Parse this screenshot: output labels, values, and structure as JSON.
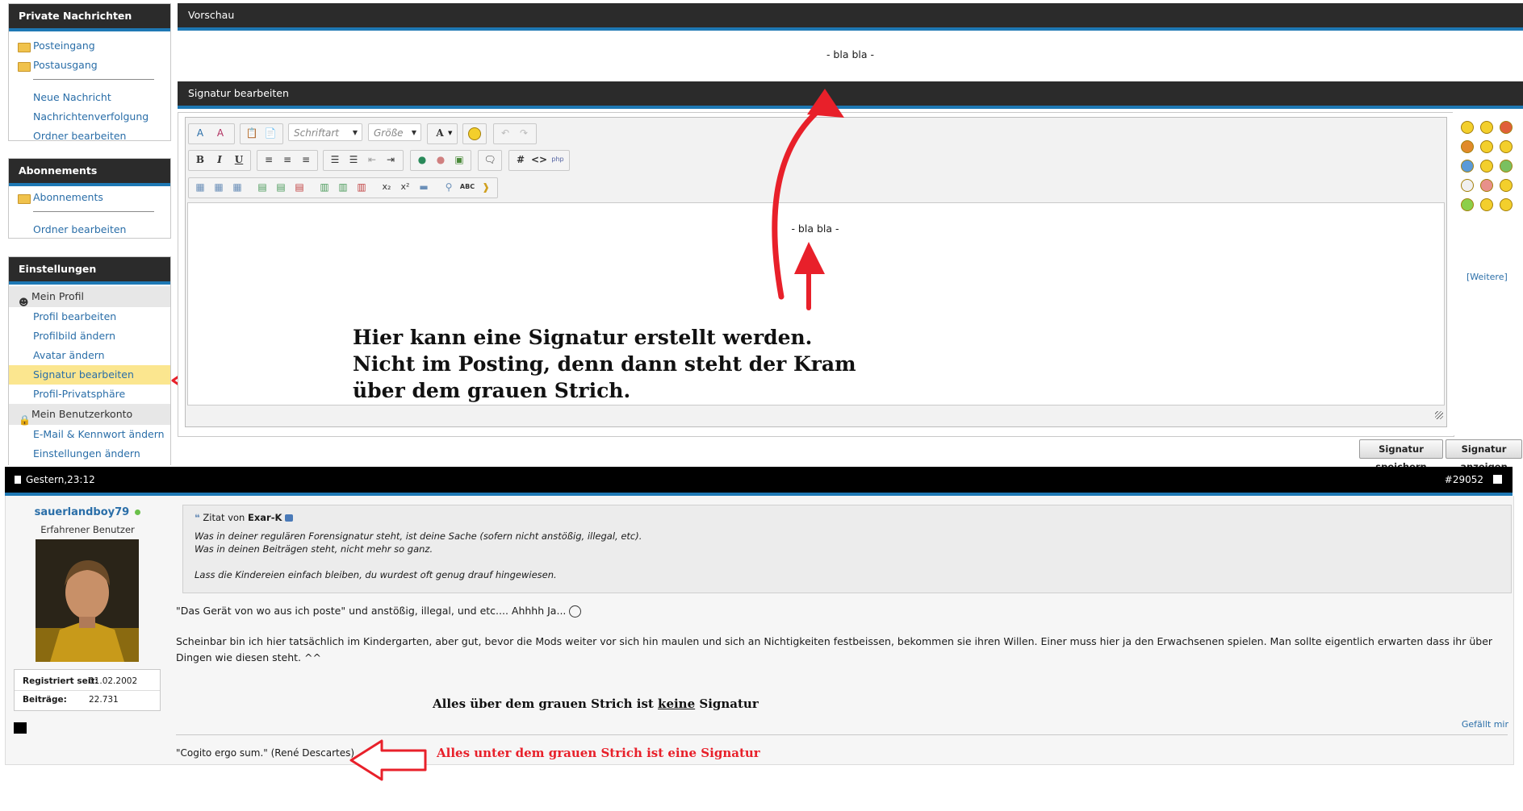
{
  "sidebar": {
    "private_messages": {
      "title": "Private Nachrichten",
      "items": [
        "Posteingang",
        "Postausgang"
      ],
      "links": [
        "Neue Nachricht",
        "Nachrichtenverfolgung",
        "Ordner bearbeiten"
      ]
    },
    "subscriptions": {
      "title": "Abonnements",
      "items": [
        "Abonnements"
      ],
      "links": [
        "Ordner bearbeiten"
      ]
    },
    "settings": {
      "title": "Einstellungen",
      "my_profile": "Mein Profil",
      "profile_items": [
        "Profil bearbeiten",
        "Profilbild ändern",
        "Avatar ändern",
        "Signatur bearbeiten",
        "Profil-Privatsphäre"
      ],
      "my_account": "Mein Benutzerkonto",
      "account_items": [
        "E-Mail & Kennwort ändern",
        "Einstellungen ändern"
      ]
    }
  },
  "preview": {
    "title": "Vorschau",
    "text": "- bla bla -"
  },
  "editor": {
    "title": "Signatur bearbeiten",
    "font_placeholder": "Schriftart",
    "size_placeholder": "Größe",
    "content": "- bla bla -",
    "more_smilies": "[Weitere]",
    "save_button": "Signatur speichern",
    "show_button": "Signatur anzeigen"
  },
  "annotations": {
    "editor_note": "Hier kann eine Signatur erstellt werden. Nicht im Posting, denn dann steht der Kram über dem grauen Strich.",
    "above_line_pre": "Alles über dem grauen Strich ist ",
    "above_line_emph": "keine",
    "above_line_post": " Signatur",
    "below_line": "Alles unter dem grauen Strich ist eine Signatur",
    "colors": {
      "arrow": "#e8202a",
      "highlight": "#fbe68f",
      "accent": "#1e78b4"
    }
  },
  "post": {
    "date": "Gestern,23:12",
    "post_id": "#29052",
    "username": "sauerlandboy79",
    "rank": "Erfahrener Benutzer",
    "registered_label": "Registriert seit:",
    "registered_value": "01.02.2002",
    "posts_label": "Beiträge:",
    "posts_value": "22.731",
    "quote_prefix": "Zitat von",
    "quote_author": "Exar-K",
    "quote_lines": [
      "Was in deiner regulären Forensignatur steht, ist deine Sache (sofern nicht anstößig, illegal, etc).",
      "Was in deinen Beiträgen steht, nicht mehr so ganz.",
      "Lass die Kindereien einfach bleiben, du wurdest oft genug drauf hingewiesen."
    ],
    "body_1": "\"Das Gerät von wo aus ich poste\" und anstößig, illegal, und etc.... Ahhhh Ja...",
    "body_2": "Scheinbar bin ich hier tatsächlich im Kindergarten, aber gut, bevor die Mods weiter vor sich hin maulen und sich an Nichtigkeiten festbeissen, bekommen sie ihren Willen. Einer muss hier ja den Erwachsenen spielen. Man sollte eigentlich erwarten dass ihr über Dingen wie diesen steht. ^^",
    "like_link": "Gefällt mir",
    "signature": "\"Cogito ergo sum.\" (René Descartes)"
  }
}
